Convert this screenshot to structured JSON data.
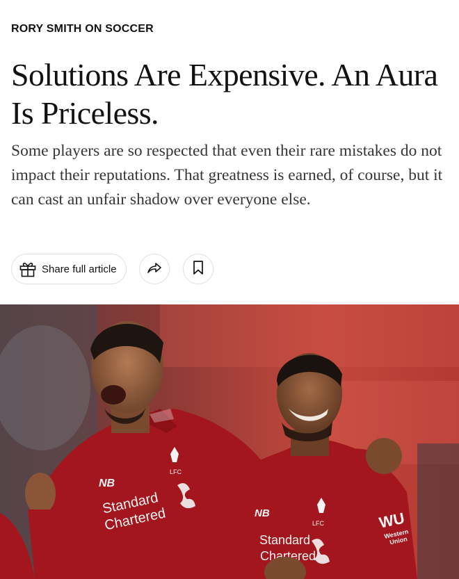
{
  "article": {
    "kicker": "RORY SMITH ON SOCCER",
    "headline": "Solutions Are Expensive. An Aura Is Priceless.",
    "summary": "Some players are so respected that even their rare mistakes do not impact their reputations. That greatness is earned, of course, but it can cast an unfair shadow over everyone else."
  },
  "actions": {
    "share_label": "Share full article",
    "share_icon": "gift-icon",
    "forward_icon": "forward-arrow-icon",
    "save_icon": "bookmark-icon"
  },
  "photo": {
    "jersey_sponsor_left": [
      "Standard",
      "Chartered"
    ],
    "jersey_sponsor_right": [
      "Standard",
      "Chartered"
    ],
    "crest_text": "LFC",
    "sleeve_sponsor": "WU",
    "sleeve_sponsor_sub": [
      "Western",
      "Union"
    ],
    "colors": {
      "jersey": "#a4161d",
      "background_stand": "#c0332c"
    }
  }
}
